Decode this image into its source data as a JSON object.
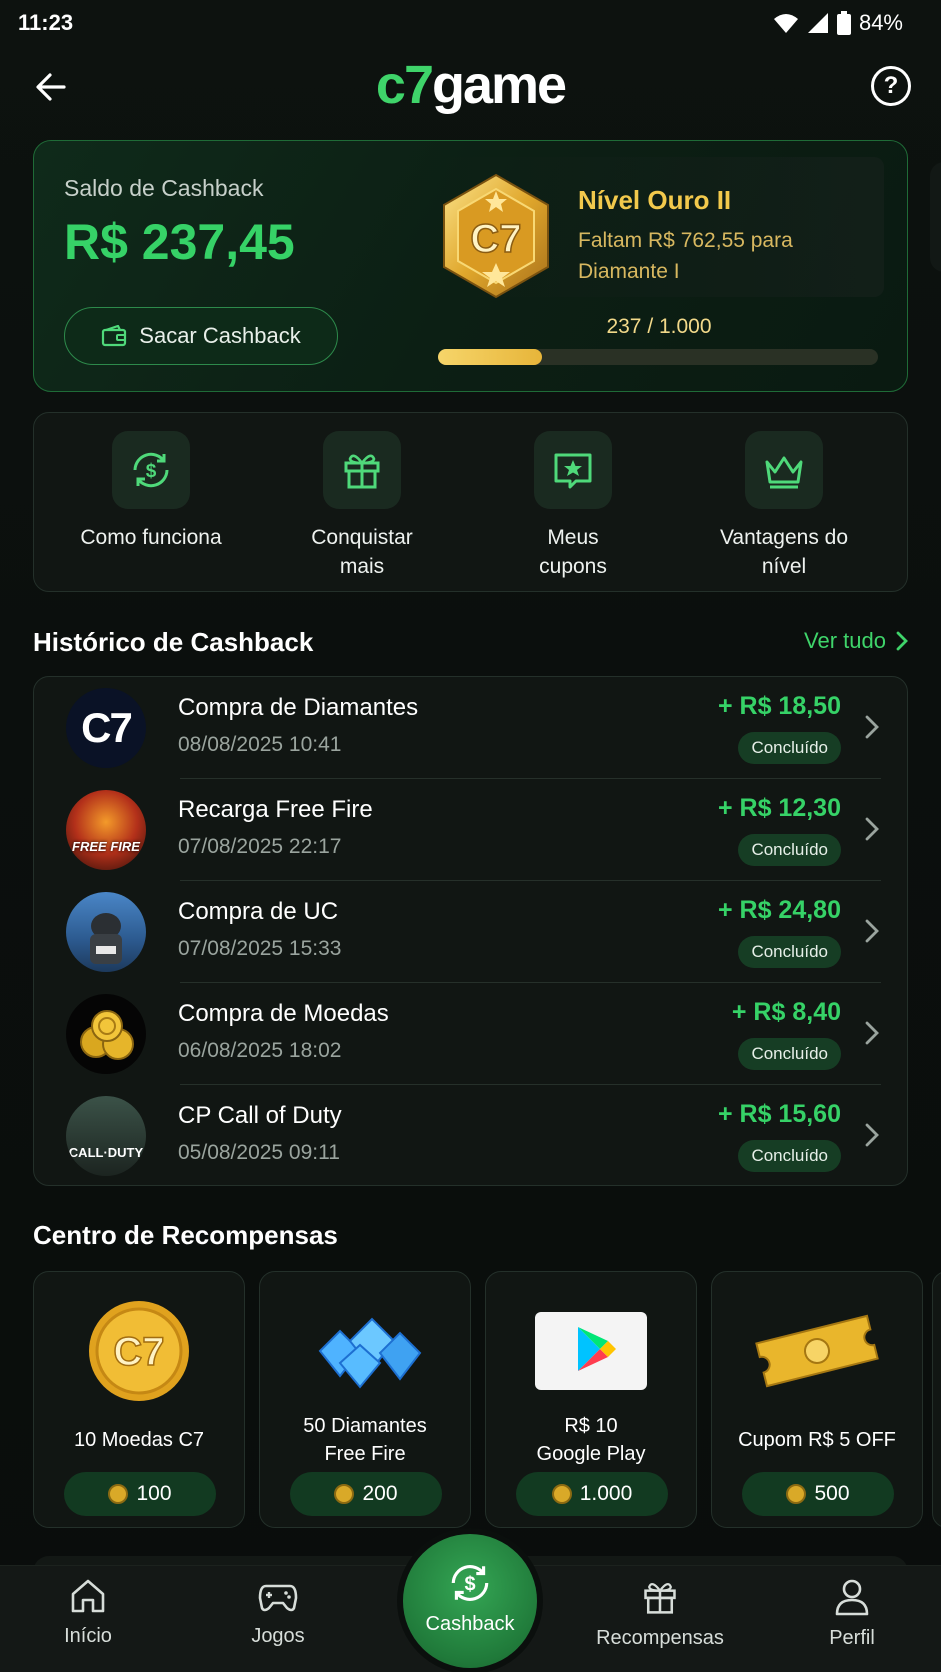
{
  "status_bar": {
    "time": "11:23",
    "battery": "84%"
  },
  "header": {
    "logo_prefix": "c7",
    "logo_suffix": "game",
    "help_glyph": "?"
  },
  "cashback": {
    "label": "Saldo de Cashback",
    "amount": "R$ 237,45",
    "withdraw_label": "Sacar Cashback",
    "badge_text": "C7",
    "level_title": "Nível Ouro II",
    "level_subtitle": "Faltam R$ 762,55 para Diamante I",
    "progress_text": "237 / 1.000",
    "progress_current": 237,
    "progress_max": 1000
  },
  "quick_actions": [
    {
      "label": "Como funciona",
      "icon": "dollar-cycle-icon"
    },
    {
      "label": "Conquistar mais",
      "icon": "gift-icon"
    },
    {
      "label": "Meus cupons",
      "icon": "coupon-star-icon"
    },
    {
      "label": "Vantagens do nível",
      "icon": "crown-icon"
    }
  ],
  "history": {
    "title": "Histórico de Cashback",
    "see_all": "Ver tudo",
    "items": [
      {
        "title": "Compra de Diamantes",
        "date": "08/08/2025 10:41",
        "amount": "+ R$ 18,50",
        "status": "Concluído",
        "avatar": "c7-logo"
      },
      {
        "title": "Recarga Free Fire",
        "date": "07/08/2025 22:17",
        "amount": "+ R$ 12,30",
        "status": "Concluído",
        "avatar": "free-fire"
      },
      {
        "title": "Compra de UC",
        "date": "07/08/2025 15:33",
        "amount": "+ R$ 24,80",
        "status": "Concluído",
        "avatar": "pubg"
      },
      {
        "title": "Compra de Moedas",
        "date": "06/08/2025 18:02",
        "amount": "+ R$ 8,40",
        "status": "Concluído",
        "avatar": "coins"
      },
      {
        "title": "CP Call of Duty",
        "date": "05/08/2025 09:11",
        "amount": "+ R$ 15,60",
        "status": "Concluído",
        "avatar": "call-of-duty"
      }
    ]
  },
  "rewards": {
    "title": "Centro de Recompensas",
    "items": [
      {
        "line1": "10 Moedas C7",
        "line2": "",
        "price": "100",
        "image": "c7-coin"
      },
      {
        "line1": "50 Diamantes",
        "line2": "Free Fire",
        "price": "200",
        "image": "diamonds"
      },
      {
        "line1": "R$ 10",
        "line2": "Google Play",
        "price": "1.000",
        "image": "google-play-card"
      },
      {
        "line1": "Cupom R$ 5 OFF",
        "line2": "",
        "price": "500",
        "image": "gold-ticket"
      }
    ]
  },
  "avatar_text": {
    "c7": "C7",
    "free_fire": "FREE FIRE",
    "cod": "CALL·DUTY",
    "coin": "C7"
  },
  "bottom_nav": {
    "items": [
      {
        "label": "Início",
        "icon": "home-icon"
      },
      {
        "label": "Jogos",
        "icon": "gamepad-icon"
      },
      {
        "label": "Cashback",
        "icon": "dollar-cycle-icon"
      },
      {
        "label": "Recompensas",
        "icon": "gift-icon"
      },
      {
        "label": "Perfil",
        "icon": "user-icon"
      }
    ]
  },
  "colors": {
    "accent": "#36d267",
    "gold": "#f2c94c",
    "background": "#0b0f0d",
    "card": "#111613"
  }
}
